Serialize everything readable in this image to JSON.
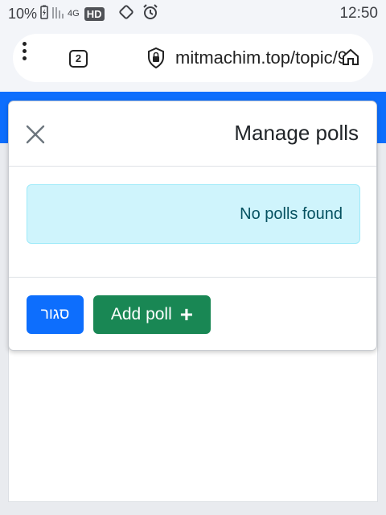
{
  "status_bar": {
    "battery": "10%",
    "network": "4G",
    "hd": "HD",
    "time": "12:50"
  },
  "browser": {
    "tab_count": "2",
    "url": "mitmachim.top/topic/9"
  },
  "modal": {
    "title": "Manage polls",
    "empty_message": "No polls found",
    "close_button_label": "סגור",
    "add_poll_label": "Add poll",
    "add_poll_icon": "+"
  },
  "colors": {
    "primary": "#0d6efd",
    "success": "#198754",
    "info_bg": "#cff4fc",
    "info_text": "#055160"
  },
  "icons": [
    "battery-charging-icon",
    "signal-icon",
    "rotate-icon",
    "alarm-icon",
    "menu-dots-icon",
    "tabs-icon",
    "lock-icon",
    "home-icon",
    "close-icon",
    "plus-icon"
  ]
}
